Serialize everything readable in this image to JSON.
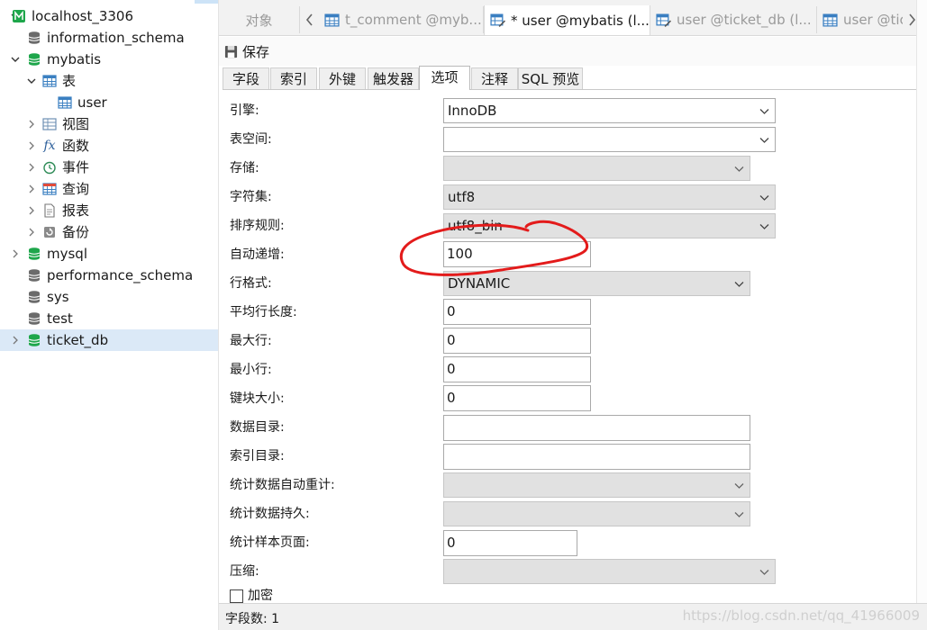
{
  "sidebar": {
    "connection": "localhost_3306",
    "items": [
      {
        "label": "information_schema"
      },
      {
        "label": "mybatis"
      },
      {
        "label": "表"
      },
      {
        "label": "user"
      },
      {
        "label": "视图"
      },
      {
        "label": "函数"
      },
      {
        "label": "事件"
      },
      {
        "label": "查询"
      },
      {
        "label": "报表"
      },
      {
        "label": "备份"
      },
      {
        "label": "mysql"
      },
      {
        "label": "performance_schema"
      },
      {
        "label": "sys"
      },
      {
        "label": "test"
      },
      {
        "label": "ticket_db"
      }
    ]
  },
  "tabs": [
    {
      "label": "对象"
    },
    {
      "label": "t_comment @myb..."
    },
    {
      "label": "* user @mybatis (l..."
    },
    {
      "label": "user @ticket_db (l..."
    },
    {
      "label": "user @tic"
    }
  ],
  "toolbar": {
    "save_label": "保存"
  },
  "subtabs": [
    "字段",
    "索引",
    "外键",
    "触发器",
    "选项",
    "注释",
    "SQL 预览"
  ],
  "form": {
    "engine": {
      "label": "引擎:",
      "value": "InnoDB"
    },
    "tablespace": {
      "label": "表空间:",
      "value": ""
    },
    "storage": {
      "label": "存储:",
      "value": ""
    },
    "charset": {
      "label": "字符集:",
      "value": "utf8"
    },
    "collation": {
      "label": "排序规则:",
      "value": "utf8_bin"
    },
    "auto_increment": {
      "label": "自动递增:",
      "value": "100"
    },
    "row_format": {
      "label": "行格式:",
      "value": "DYNAMIC"
    },
    "avg_row_length": {
      "label": "平均行长度:",
      "value": "0"
    },
    "max_rows": {
      "label": "最大行:",
      "value": "0"
    },
    "min_rows": {
      "label": "最小行:",
      "value": "0"
    },
    "key_block_size": {
      "label": "键块大小:",
      "value": "0"
    },
    "data_directory": {
      "label": "数据目录:",
      "value": ""
    },
    "index_directory": {
      "label": "索引目录:",
      "value": ""
    },
    "stats_auto_recalc": {
      "label": "统计数据自动重计:",
      "value": ""
    },
    "stats_persistent": {
      "label": "统计数据持久:",
      "value": ""
    },
    "stats_sample_pages": {
      "label": "统计样本页面:",
      "value": "0"
    },
    "compression": {
      "label": "压缩:",
      "value": ""
    },
    "encryption": {
      "label": "加密"
    }
  },
  "status": {
    "field_count": "字段数: 1",
    "watermark": "https://blog.csdn.net/qq_41966009"
  },
  "colors": {
    "accent_selection": "#dbe9f7",
    "db_icon_green": "#1ea64b",
    "annotation_red": "#e31b1b"
  }
}
